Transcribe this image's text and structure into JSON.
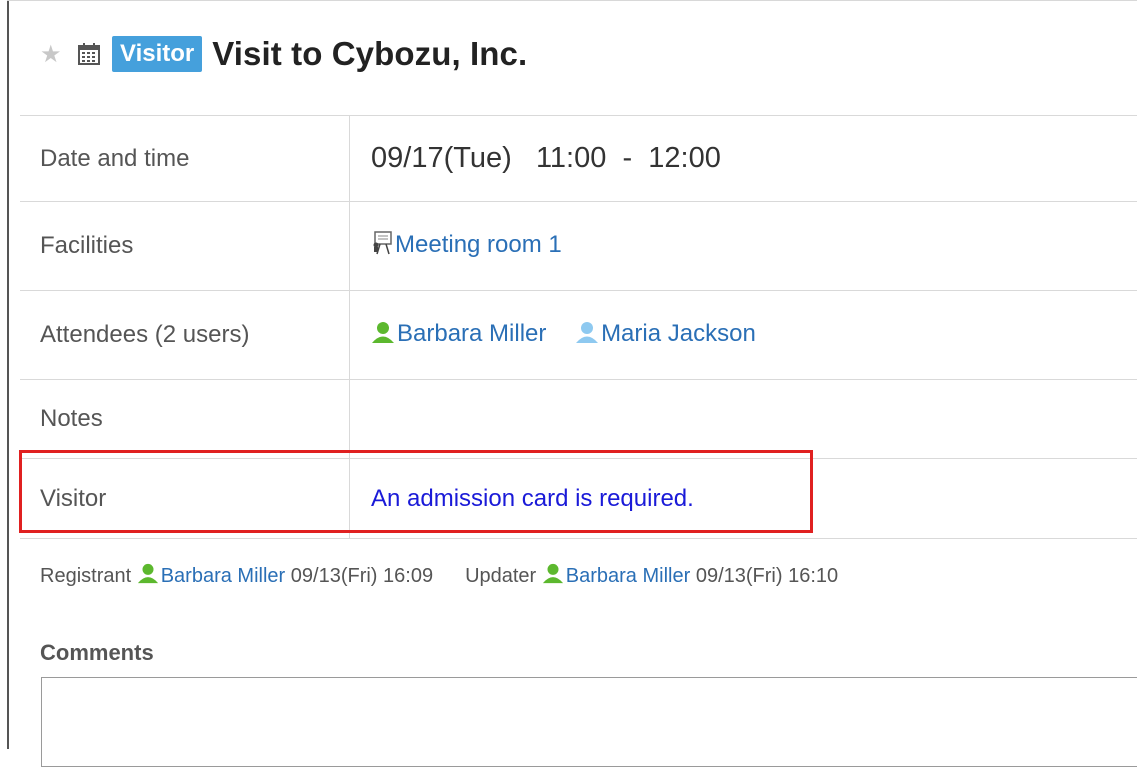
{
  "header": {
    "badge": "Visitor",
    "title": "Visit to Cybozu, Inc."
  },
  "details": {
    "date_label": "Date and time",
    "date_value": "09/17(Tue)   11:00  -  12:00",
    "facilities_label": "Facilities",
    "facility": "Meeting room 1",
    "attendees_label": "Attendees (2 users)",
    "attendees": [
      "Barbara Miller",
      "Maria Jackson"
    ],
    "notes_label": "Notes",
    "notes_value": "",
    "visitor_label": "Visitor",
    "visitor_value": "An admission card is required."
  },
  "meta": {
    "registrant_label": "Registrant",
    "registrant_name": "Barbara Miller",
    "registrant_time": "09/13(Fri) 16:09",
    "updater_label": "Updater",
    "updater_name": "Barbara Miller",
    "updater_time": "09/13(Fri) 16:10"
  },
  "comments": {
    "label": "Comments"
  },
  "colors": {
    "badge_bg": "#45a0dc",
    "link": "#2a6fb6",
    "highlight": "#e02020"
  }
}
